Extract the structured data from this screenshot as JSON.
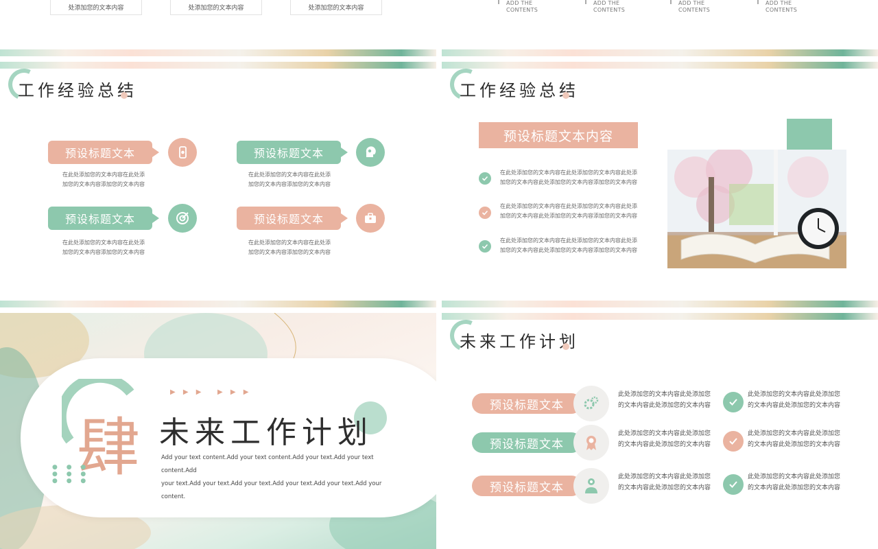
{
  "colors": {
    "pink": "#eab3a0",
    "green": "#8dc8ad",
    "text": "#2c2c2c"
  },
  "top_left": {
    "boxes": [
      "处添加您的文本内容",
      "处添加您的文本内容",
      "处添加您的文本内容"
    ]
  },
  "top_right": {
    "items": [
      {
        "line1": "ADD THE",
        "line2": "CONTENTS"
      },
      {
        "line1": "ADD THE",
        "line2": "CONTENTS"
      },
      {
        "line1": "ADD THE",
        "line2": "CONTENTS"
      },
      {
        "line1": "ADD THE",
        "line2": "CONTENTS"
      }
    ]
  },
  "mid_left": {
    "title": "工作经验总结",
    "cards": [
      {
        "label": "预设标题文本",
        "text1": "在此处添加您的文本内容在此处添",
        "text2": "加您的文本内容添加您的文本内容",
        "icon": "phone-icon"
      },
      {
        "label": "预设标题文本",
        "text1": "在此处添加您的文本内容在此处添",
        "text2": "加您的文本内容添加您的文本内容",
        "icon": "head-gears-icon"
      },
      {
        "label": "预设标题文本",
        "text1": "在此处添加您的文本内容在此处添",
        "text2": "加您的文本内容添加您的文本内容",
        "icon": "target-icon"
      },
      {
        "label": "预设标题文本",
        "text1": "在此处添加您的文本内容在此处添",
        "text2": "加您的文本内容添加您的文本内容",
        "icon": "briefcase-icon"
      }
    ]
  },
  "mid_right": {
    "title": "工作经验总结",
    "header": "预设标题文本内容",
    "items": [
      {
        "text1": "在此处添加您的文本内容在此处添加您的文本内容此处添",
        "text2": "加您的文本内容此处添加您的文本内容添加您的文本内容"
      },
      {
        "text1": "在此处添加您的文本内容在此处添加您的文本内容此处添",
        "text2": "加您的文本内容此处添加您的文本内容添加您的文本内容"
      },
      {
        "text1": "在此处添加您的文本内容在此处添加您的文本内容此处添",
        "text2": "加您的文本内容此处添加您的文本内容添加您的文本内容"
      }
    ]
  },
  "bottom_left": {
    "numeral": "肆",
    "title": "未来工作计划",
    "subtitle1": "Add your text content.Add your text content.Add your text.Add your text content.Add",
    "subtitle2": "your text.Add your text.Add your text.Add your text.Add your text.Add your content.",
    "triangles": "▶ ▶ ▶"
  },
  "bottom_right": {
    "title": "未来工作计划",
    "rows": [
      {
        "label": "预设标题文本",
        "icon": "gears-icon",
        "desc1a": "此处添加您的文本内容此处添加您",
        "desc1b": "的文本内容此处添加您的文本内容",
        "desc2a": "此处添加您的文本内容此处添加您",
        "desc2b": "的文本内容此处添加您的文本内容"
      },
      {
        "label": "预设标题文本",
        "icon": "award-icon",
        "desc1a": "此处添加您的文本内容此处添加您",
        "desc1b": "的文本内容此处添加您的文本内容",
        "desc2a": "此处添加您的文本内容此处添加您",
        "desc2b": "的文本内容此处添加您的文本内容"
      },
      {
        "label": "预设标题文本",
        "icon": "user-pin-icon",
        "desc1a": "此处添加您的文本内容此处添加您",
        "desc1b": "的文本内容此处添加您的文本内容",
        "desc2a": "此处添加您的文本内容此处添加您",
        "desc2b": "的文本内容此处添加您的文本内容"
      }
    ]
  }
}
